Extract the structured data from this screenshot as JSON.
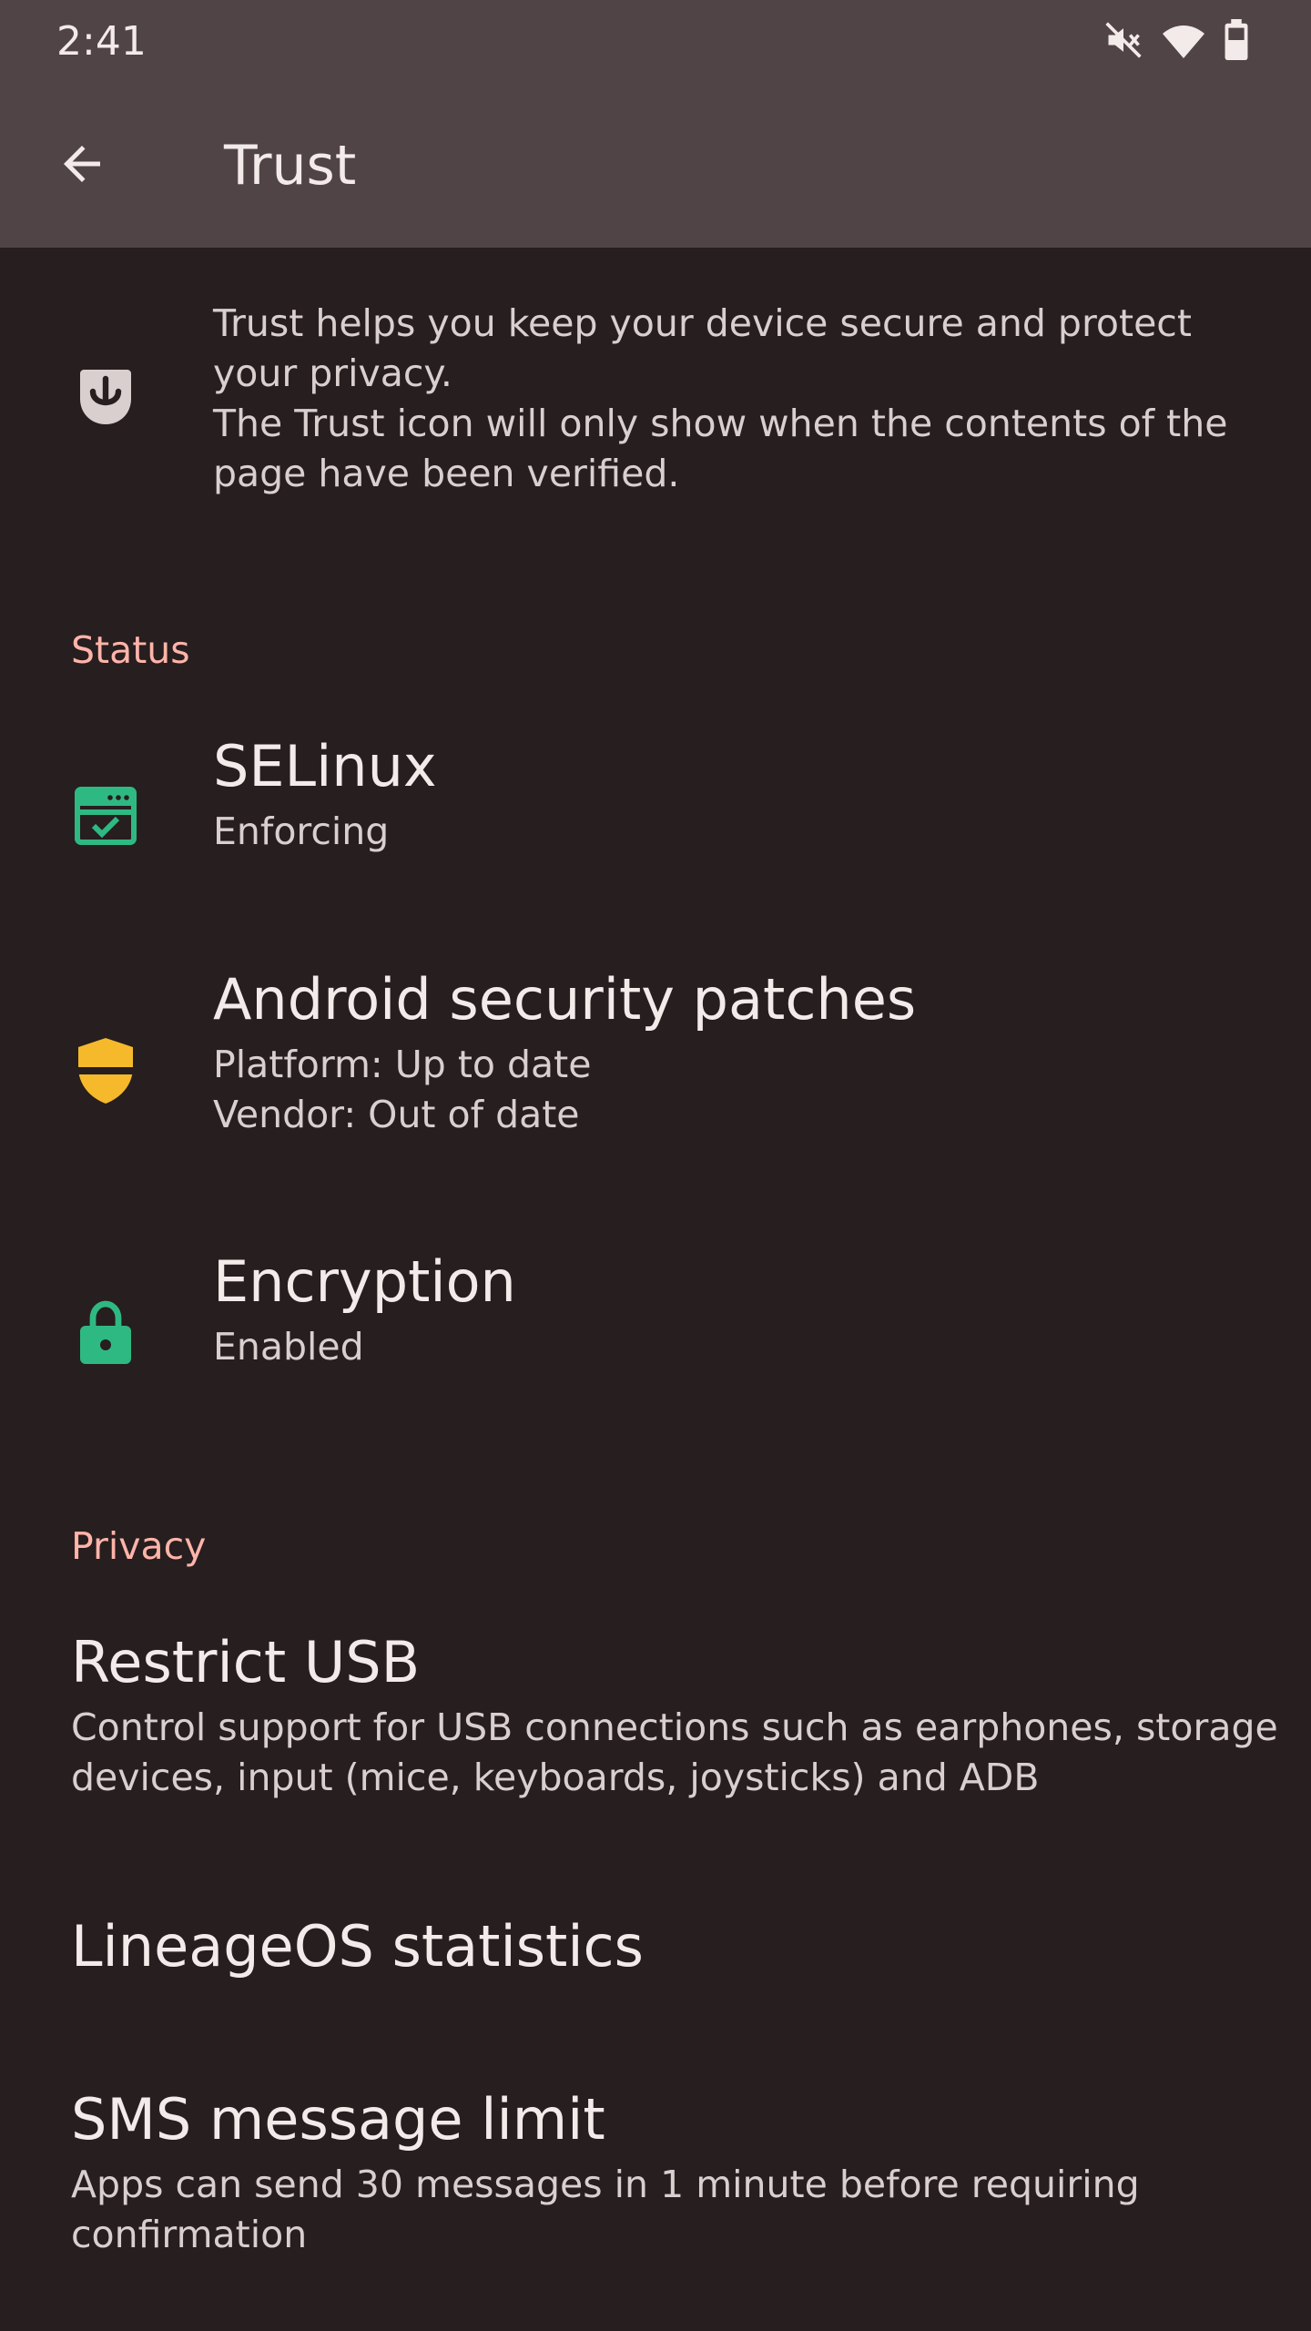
{
  "status_bar": {
    "time": "2:41",
    "icons": [
      "mute-icon",
      "wifi-icon",
      "battery-icon"
    ]
  },
  "app_bar": {
    "title": "Trust",
    "back_icon": "arrow-back-icon"
  },
  "intro": {
    "icon": "trust-icon",
    "text": "Trust helps you keep your device secure and protect\nyour privacy.\nThe Trust icon will only show when the contents of the\npage have been verified."
  },
  "sections": {
    "status": {
      "header": "Status",
      "items": [
        {
          "title": "SELinux",
          "summary": "Enforcing",
          "icon": "selinux-icon",
          "icon_color": "#2fb982"
        },
        {
          "title": "Android security patches",
          "summary": "Platform: Up to date\nVendor: Out of date",
          "icon": "shield-icon",
          "icon_color": "#f5b92b"
        },
        {
          "title": "Encryption",
          "summary": "Enabled",
          "icon": "lock-icon",
          "icon_color": "#2fb982"
        }
      ]
    },
    "privacy": {
      "header": "Privacy",
      "items": [
        {
          "title": "Restrict USB",
          "summary": "Control support for USB connections such as earphones, storage\ndevices, input (mice, keyboards, joysticks) and ADB"
        },
        {
          "title": "LineageOS statistics"
        },
        {
          "title": "SMS message limit",
          "summary": "Apps can send 30 messages in 1 minute before requiring\nconfirmation"
        }
      ]
    }
  },
  "colors": {
    "background": "#261e1f",
    "app_bar": "#514446",
    "accent": "#ffb4a9",
    "text_primary": "#f3eaea",
    "text_secondary": "#d9cfcf"
  }
}
